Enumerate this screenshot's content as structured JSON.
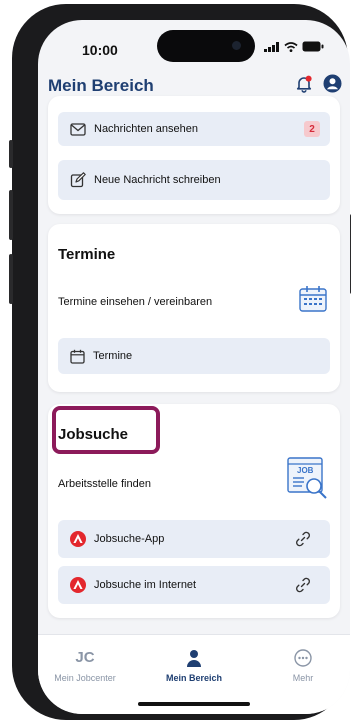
{
  "status_bar": {
    "time": "10:00"
  },
  "header": {
    "title": "Mein Bereich",
    "bell_icon": "bell-icon",
    "account_icon": "account-icon"
  },
  "messages": {
    "view_label": "Nachrichten ansehen",
    "unread_count": "2",
    "compose_label": "Neue Nachricht schreiben"
  },
  "appointments": {
    "title": "Termine",
    "subtitle": "Termine einsehen / vereinbaren",
    "button_label": "Termine"
  },
  "jobsearch": {
    "title": "Jobsuche",
    "subtitle": "Arbeitsstelle finden",
    "illustration_label": "JOB",
    "app_label": "Jobsuche-App",
    "web_label": "Jobsuche im Internet"
  },
  "tabbar": {
    "items": [
      {
        "label": "Mein Jobcenter",
        "logo": "JC"
      },
      {
        "label": "Mein Bereich"
      },
      {
        "label": "Mehr"
      }
    ]
  },
  "colors": {
    "primary": "#1f3f72",
    "highlight": "#8c1a5a",
    "badge_bg": "#f6c9cd",
    "badge_text": "#d42b3b",
    "brand_red": "#e3272d"
  }
}
